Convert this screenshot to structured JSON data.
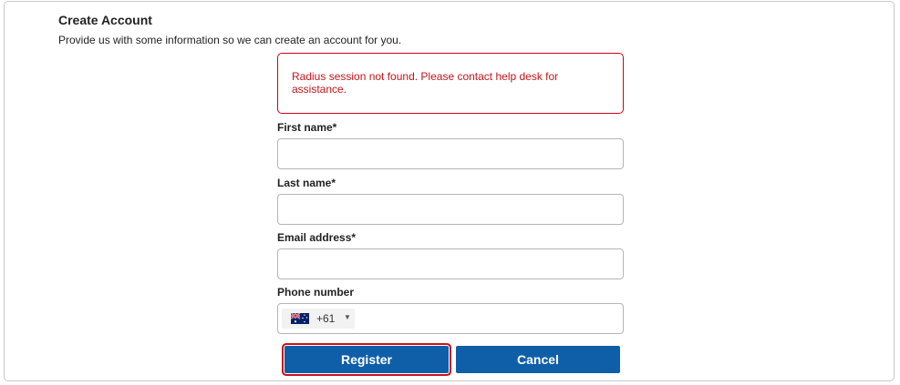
{
  "header": {
    "title": "Create Account",
    "subtitle": "Provide us with some information so we can create an account for you."
  },
  "alert": {
    "message": "Radius session not found. Please contact help desk for assistance."
  },
  "form": {
    "first_name": {
      "label": "First name*",
      "value": ""
    },
    "last_name": {
      "label": "Last name*",
      "value": ""
    },
    "email": {
      "label": "Email address*",
      "value": ""
    },
    "phone": {
      "label": "Phone number",
      "country_flag": "australia-flag-icon",
      "dial_code": "+61",
      "value": ""
    }
  },
  "actions": {
    "register_label": "Register",
    "cancel_label": "Cancel"
  },
  "colors": {
    "primary": "#0f5fa8",
    "error": "#c0151b",
    "focus_outline": "#c8121a"
  }
}
